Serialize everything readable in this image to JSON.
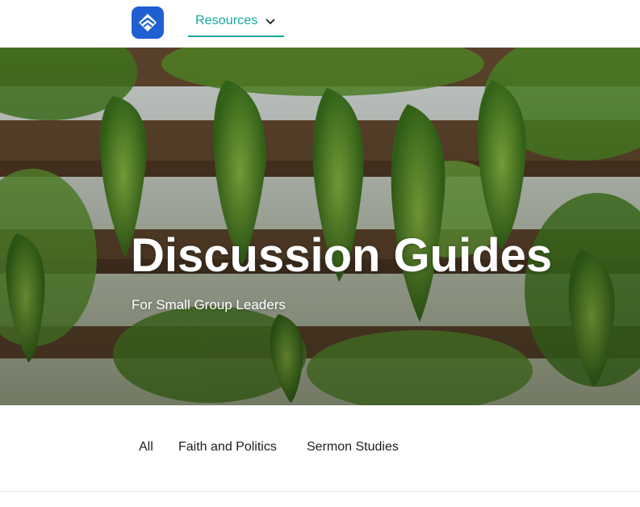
{
  "header": {
    "logo_icon": "church-logo-icon",
    "nav": {
      "resources_label": "Resources",
      "chevron_icon": "chevron-down-icon"
    },
    "accent_color": "#12a89d",
    "logo_color": "#1f5fd1"
  },
  "hero": {
    "title": "Discussion Guides",
    "subtitle": "For Small Group Leaders",
    "background": "grapevine-pergola-photo"
  },
  "filters": {
    "items": [
      {
        "label": "All"
      },
      {
        "label": "Faith and Politics"
      },
      {
        "label": "Sermon Studies"
      }
    ]
  }
}
